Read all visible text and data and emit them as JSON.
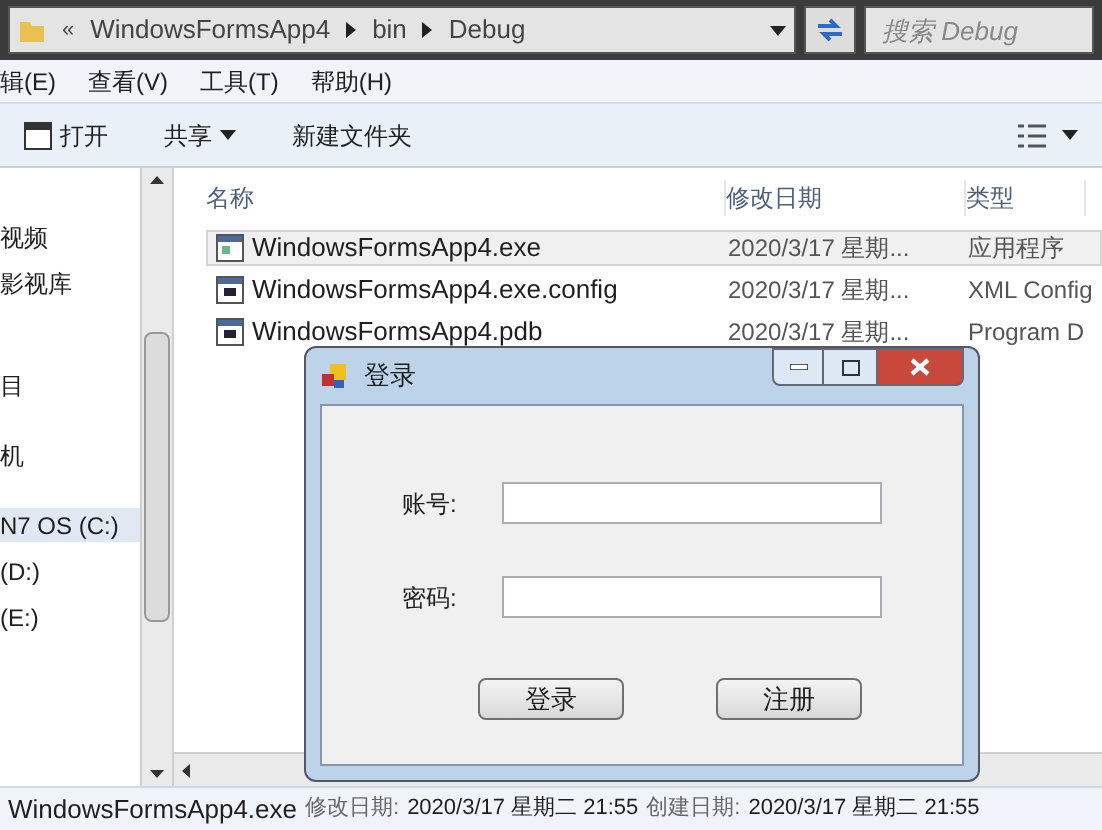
{
  "address_bar": {
    "prefix": "«",
    "crumbs": [
      "WindowsFormsApp4",
      "bin",
      "Debug"
    ],
    "search_placeholder": "搜索 Debug"
  },
  "menu": [
    "辑(E)",
    "查看(V)",
    "工具(T)",
    "帮助(H)"
  ],
  "toolbar": [
    {
      "label": "打开",
      "kind": "icon"
    },
    {
      "label": "共享",
      "kind": "dropdown"
    },
    {
      "label": "新建文件夹",
      "kind": "plain"
    }
  ],
  "sidebar": {
    "items": [
      {
        "label": "视频",
        "selected": false
      },
      {
        "label": "影视库",
        "selected": false
      },
      {
        "label": "目",
        "selected": false
      },
      {
        "label": "机",
        "selected": false
      },
      {
        "label": "N7 OS (C:)",
        "selected": true
      },
      {
        "label": "(D:)",
        "selected": false
      },
      {
        "label": "(E:)",
        "selected": false
      }
    ]
  },
  "table": {
    "columns": [
      "名称",
      "修改日期",
      "类型"
    ],
    "rows": [
      {
        "name": "WindowsFormsApp4.exe",
        "date": "2020/3/17 星期...",
        "type": "应用程序",
        "selected": true
      },
      {
        "name": "WindowsFormsApp4.exe.config",
        "date": "2020/3/17 星期...",
        "type": "XML Config",
        "selected": false
      },
      {
        "name": "WindowsFormsApp4.pdb",
        "date": "2020/3/17 星期...",
        "type": "Program D",
        "selected": false
      }
    ]
  },
  "dialog": {
    "title": "登录",
    "fields": [
      {
        "label": "账号:"
      },
      {
        "label": "密码:"
      }
    ],
    "buttons": [
      "登录",
      "注册"
    ]
  },
  "status_bar": {
    "name": "WindowsFormsApp4.exe",
    "modified_label": "修改日期:",
    "modified": "2020/3/17 星期二 21:55",
    "created_label": "创建日期:",
    "created": "2020/3/17 星期二 21:55"
  }
}
